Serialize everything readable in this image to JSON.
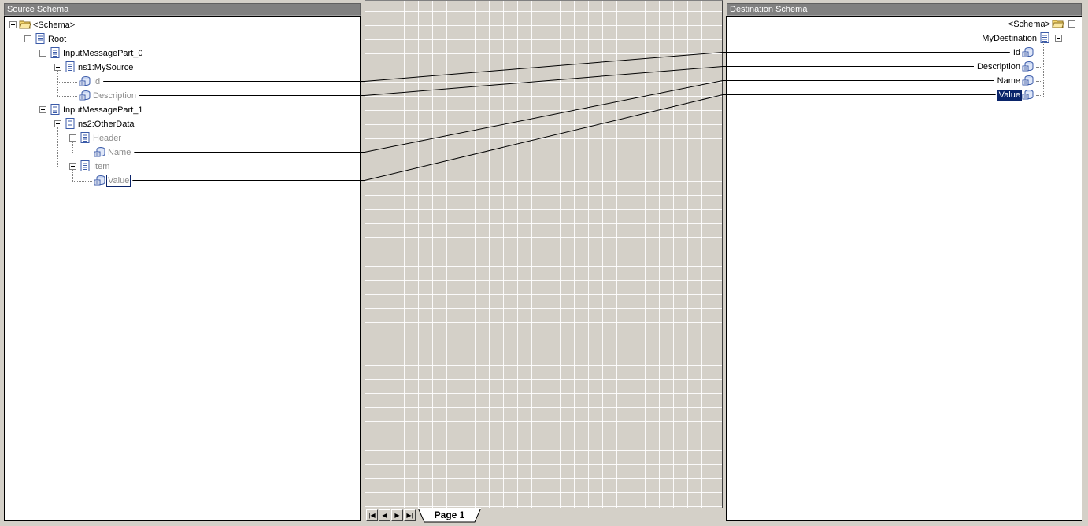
{
  "source": {
    "title": "Source Schema",
    "nodes": [
      {
        "label": "<Schema>",
        "icon": "folder-icon",
        "style": "normal"
      },
      {
        "label": "Root",
        "icon": "record-icon",
        "style": "normal"
      },
      {
        "label": "InputMessagePart_0",
        "icon": "record-icon",
        "style": "normal"
      },
      {
        "label": "ns1:MySource",
        "icon": "record-icon",
        "style": "normal"
      },
      {
        "label": "Id",
        "icon": "field-icon",
        "style": "dim"
      },
      {
        "label": "Description",
        "icon": "field-icon",
        "style": "dim"
      },
      {
        "label": "InputMessagePart_1",
        "icon": "record-icon",
        "style": "normal"
      },
      {
        "label": "ns2:OtherData",
        "icon": "record-icon",
        "style": "normal"
      },
      {
        "label": "Header",
        "icon": "record-icon",
        "style": "dim"
      },
      {
        "label": "Name",
        "icon": "field-icon",
        "style": "dim"
      },
      {
        "label": "Item",
        "icon": "record-icon",
        "style": "dim"
      },
      {
        "label": "Value",
        "icon": "field-icon",
        "style": "focus"
      }
    ]
  },
  "destination": {
    "title": "Destination Schema",
    "nodes": [
      {
        "label": "<Schema>",
        "icon": "folder-icon",
        "style": "normal"
      },
      {
        "label": "MyDestination",
        "icon": "record-icon",
        "style": "normal"
      },
      {
        "label": "Id",
        "icon": "field-icon",
        "style": "normal"
      },
      {
        "label": "Description",
        "icon": "field-icon",
        "style": "normal"
      },
      {
        "label": "Name",
        "icon": "field-icon",
        "style": "normal"
      },
      {
        "label": "Value",
        "icon": "field-icon",
        "style": "selected"
      }
    ]
  },
  "links": [
    {
      "from": "Id",
      "to": "Id"
    },
    {
      "from": "Description",
      "to": "Description"
    },
    {
      "from": "Name",
      "to": "Name"
    },
    {
      "from": "Value",
      "to": "Value"
    }
  ],
  "grid_pages": {
    "nav_buttons": [
      {
        "name": "first-page-button",
        "glyph": "|◀"
      },
      {
        "name": "prev-page-button",
        "glyph": "◀"
      },
      {
        "name": "next-page-button",
        "glyph": "▶"
      },
      {
        "name": "last-page-button",
        "glyph": "▶|"
      }
    ],
    "active_tab": "Page 1"
  },
  "colors": {
    "selection": "#0a246a",
    "title_bar": "#808080",
    "dim_text": "#8a8a8a"
  }
}
